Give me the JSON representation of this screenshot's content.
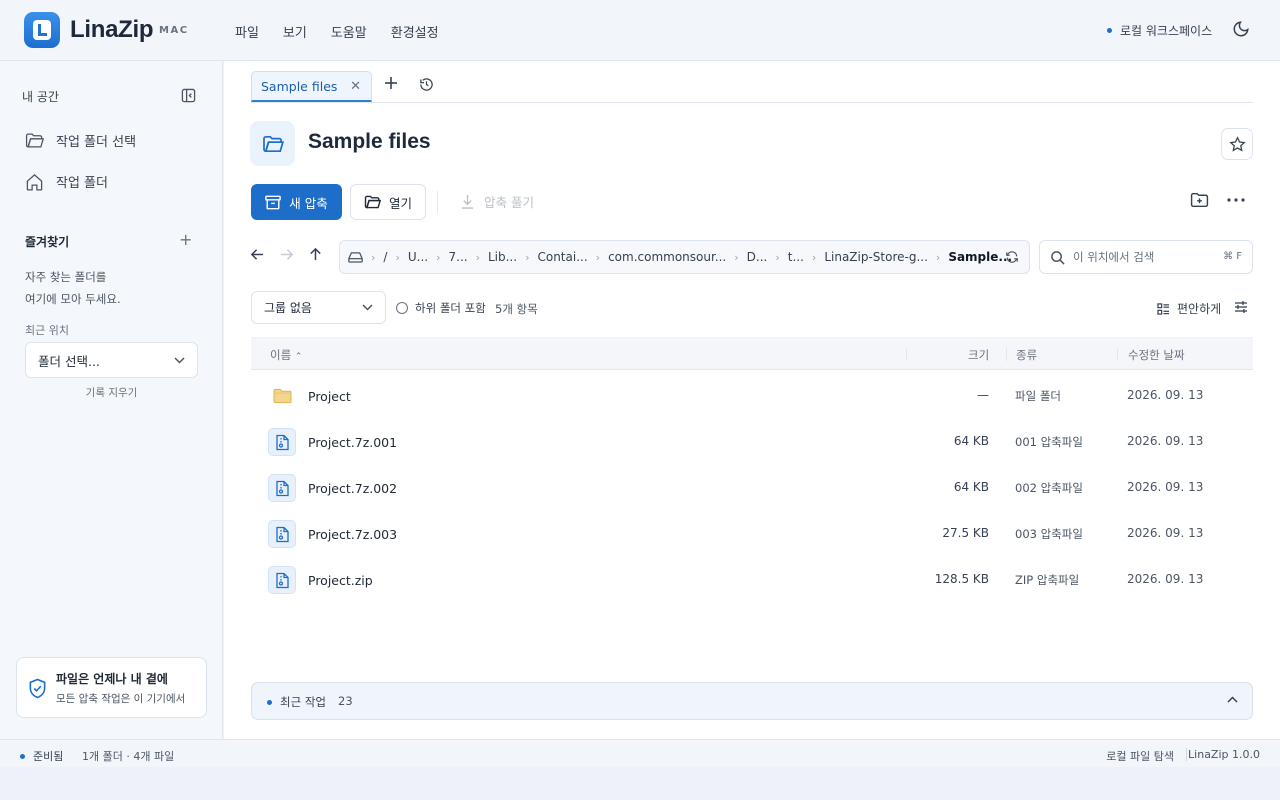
{
  "app": {
    "name": "LinaZip",
    "badge": "MAC"
  },
  "menu": [
    "파일",
    "보기",
    "도움말",
    "환경설정"
  ],
  "workspace": "로컬 워크스페이스",
  "sidebar": {
    "heading": "내 공간",
    "items": [
      {
        "label": "작업 폴더 선택",
        "icon": "folder-open-icon"
      },
      {
        "label": "작업 폴더",
        "icon": "home-icon"
      }
    ],
    "favorites_title": "즐겨찾기",
    "favorites_note_1": "자주 찾는 폴더를",
    "favorites_note_2": "여기에 모아 두세요.",
    "recent_label": "최근 위치",
    "recent_select": "폴더 선택...",
    "clear_history": "기록 지우기",
    "card_title": "파일은 언제나 내 곁에",
    "card_sub": "모든 압축 작업은 이 기기에서"
  },
  "tabs": [
    {
      "label": "Sample files",
      "active": true
    }
  ],
  "title": "Sample files",
  "toolbar": {
    "new_archive": "새 압축",
    "open": "열기",
    "extract": "압축 풀기"
  },
  "breadcrumb": [
    "/",
    "U...",
    "7...",
    "Lib...",
    "Contai...",
    "com.commonsour...",
    "D...",
    "t...",
    "LinaZip-Store-g...",
    "Sample..."
  ],
  "search": {
    "placeholder": "이 위치에서 검색",
    "shortcut": "⌘ F"
  },
  "filters": {
    "group": "그룹 없음",
    "include_subfolders": "하위 폴더 포함",
    "count": "5개 항목",
    "view_mode": "편안하게"
  },
  "columns": {
    "name": "이름",
    "size": "크기",
    "kind": "종류",
    "date": "수정한 날짜"
  },
  "files": [
    {
      "name": "Project",
      "size": "—",
      "kind": "파일 폴더",
      "date": "2026. 09. 13",
      "type": "folder"
    },
    {
      "name": "Project.7z.001",
      "size": "64 KB",
      "kind": "001 압축파일",
      "date": "2026. 09. 13",
      "type": "archive"
    },
    {
      "name": "Project.7z.002",
      "size": "64 KB",
      "kind": "002 압축파일",
      "date": "2026. 09. 13",
      "type": "archive"
    },
    {
      "name": "Project.7z.003",
      "size": "27.5 KB",
      "kind": "003 압축파일",
      "date": "2026. 09. 13",
      "type": "archive"
    },
    {
      "name": "Project.zip",
      "size": "128.5 KB",
      "kind": "ZIP 압축파일",
      "date": "2026. 09. 13",
      "type": "archive"
    }
  ],
  "recent_jobs": {
    "label": "최근 작업",
    "count": "23"
  },
  "status": {
    "ready": "준비됨",
    "summary": "1개 폴더 · 4개 파일",
    "mode": "로컬 파일 탐색",
    "version": "LinaZip 1.0.0"
  },
  "colors": {
    "accent": "#1d6ec9",
    "background": "#eef2f8"
  }
}
